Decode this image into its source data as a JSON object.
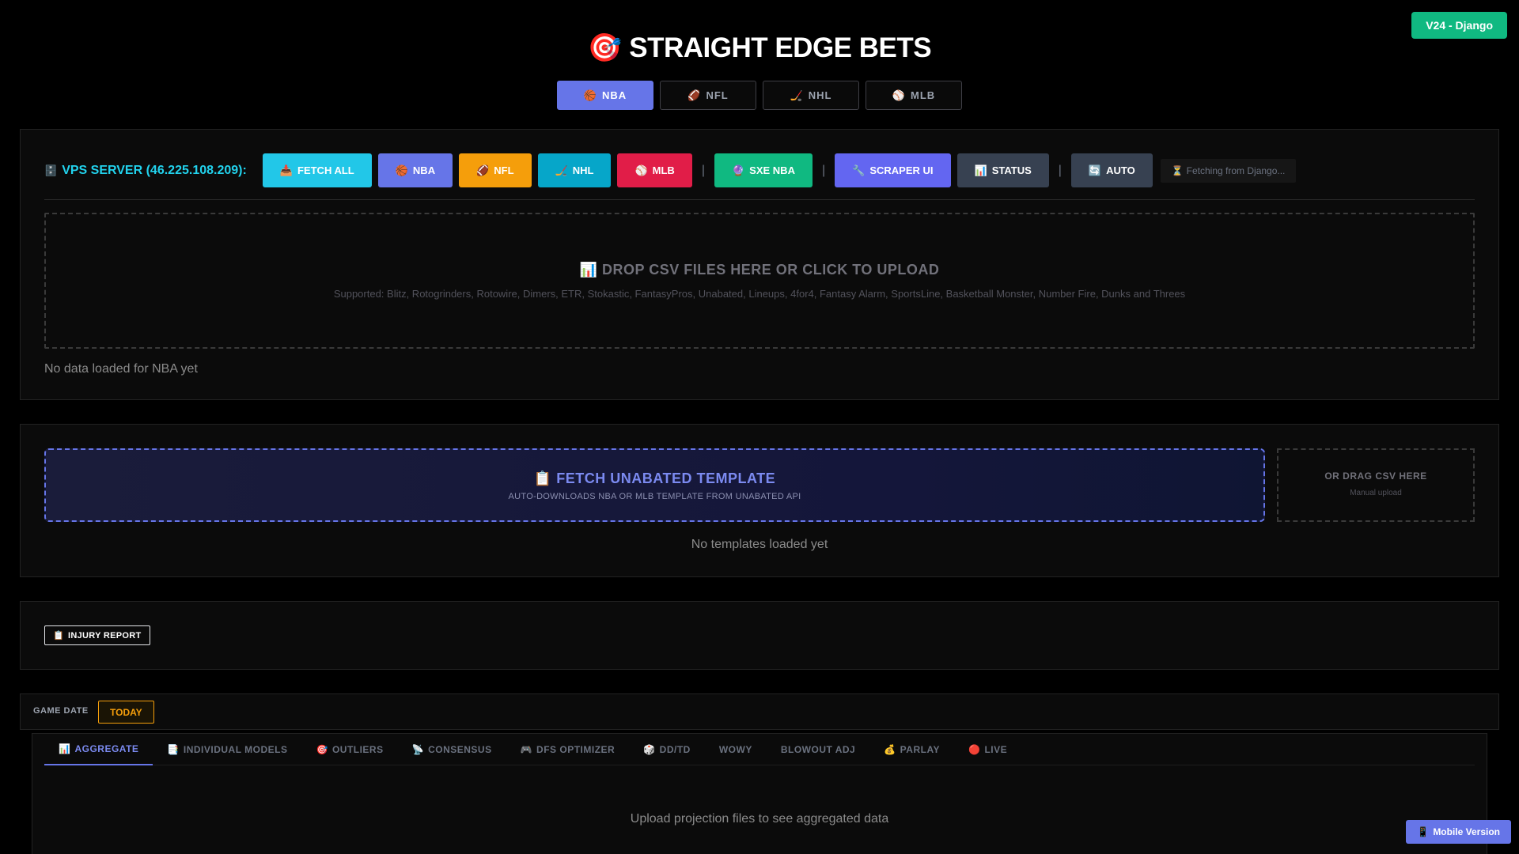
{
  "version_badge": "V24 - Django",
  "title": "STRAIGHT EDGE BETS",
  "title_icon": "🎯",
  "sport_tabs": [
    {
      "label": "NBA",
      "icon": "🏀",
      "active": true
    },
    {
      "label": "NFL",
      "icon": "🏈",
      "active": false
    },
    {
      "label": "NHL",
      "icon": "🏒",
      "active": false
    },
    {
      "label": "MLB",
      "icon": "⚾",
      "active": false
    }
  ],
  "vps": {
    "icon": "🗄️",
    "label": "VPS SERVER (46.225.108.209):",
    "buttons": [
      {
        "label": "FETCH ALL",
        "icon": "📥",
        "color": "#22c7e8"
      },
      {
        "label": "NBA",
        "icon": "🏀",
        "color": "#6675e8"
      },
      {
        "label": "NFL",
        "icon": "🏈",
        "color": "#f59e0b"
      },
      {
        "label": "NHL",
        "icon": "🏒",
        "color": "#06a6c9"
      },
      {
        "label": "MLB",
        "icon": "⚾",
        "color": "#e11d48"
      },
      {
        "label": "SXE NBA",
        "icon": "🔮",
        "color": "#10b981"
      },
      {
        "label": "SCRAPER UI",
        "icon": "🔧",
        "color": "#6366f1"
      },
      {
        "label": "STATUS",
        "icon": "📊",
        "color": "#374151"
      },
      {
        "label": "AUTO",
        "icon": "🔄",
        "color": "#374151"
      }
    ],
    "separator": "|",
    "fetching_icon": "⏳",
    "fetching_text": "Fetching from Django..."
  },
  "dropzone": {
    "icon": "📊",
    "title": "DROP CSV FILES HERE OR CLICK TO UPLOAD",
    "subtitle": "Supported: Blitz, Rotogrinders, Rotowire, Dimers, ETR, Stokastic, FantasyPros, Unabated, Lineups, 4for4, Fantasy Alarm, SportsLine, Basketball Monster, Number Fire, Dunks and Threes"
  },
  "no_data_text": "No data loaded for NBA yet",
  "template": {
    "icon": "📋",
    "title": "FETCH UNABATED TEMPLATE",
    "subtitle": "AUTO-DOWNLOADS NBA OR MLB TEMPLATE FROM UNABATED API",
    "drag_title": "OR DRAG CSV HERE",
    "drag_sub": "Manual upload",
    "empty_text": "No templates loaded yet"
  },
  "injury": {
    "icon": "📋",
    "label": "INJURY REPORT"
  },
  "game_date": {
    "label": "GAME DATE",
    "today": "TODAY"
  },
  "view_tabs": [
    {
      "label": "AGGREGATE",
      "icon": "📊",
      "active": true
    },
    {
      "label": "INDIVIDUAL MODELS",
      "icon": "📑",
      "active": false
    },
    {
      "label": "OUTLIERS",
      "icon": "🎯",
      "active": false
    },
    {
      "label": "CONSENSUS",
      "icon": "📡",
      "active": false
    },
    {
      "label": "DFS OPTIMIZER",
      "icon": "🎮",
      "active": false
    },
    {
      "label": "DD/TD",
      "icon": "🎲",
      "active": false
    },
    {
      "label": "WOWY",
      "icon": "",
      "active": false
    },
    {
      "label": "BLOWOUT ADJ",
      "icon": "",
      "active": false
    },
    {
      "label": "PARLAY",
      "icon": "💰",
      "active": false
    },
    {
      "label": "LIVE",
      "icon": "🔴",
      "active": false
    }
  ],
  "empty_message": "Upload projection files to see aggregated data",
  "mobile": {
    "icon": "📱",
    "label": "Mobile Version"
  }
}
